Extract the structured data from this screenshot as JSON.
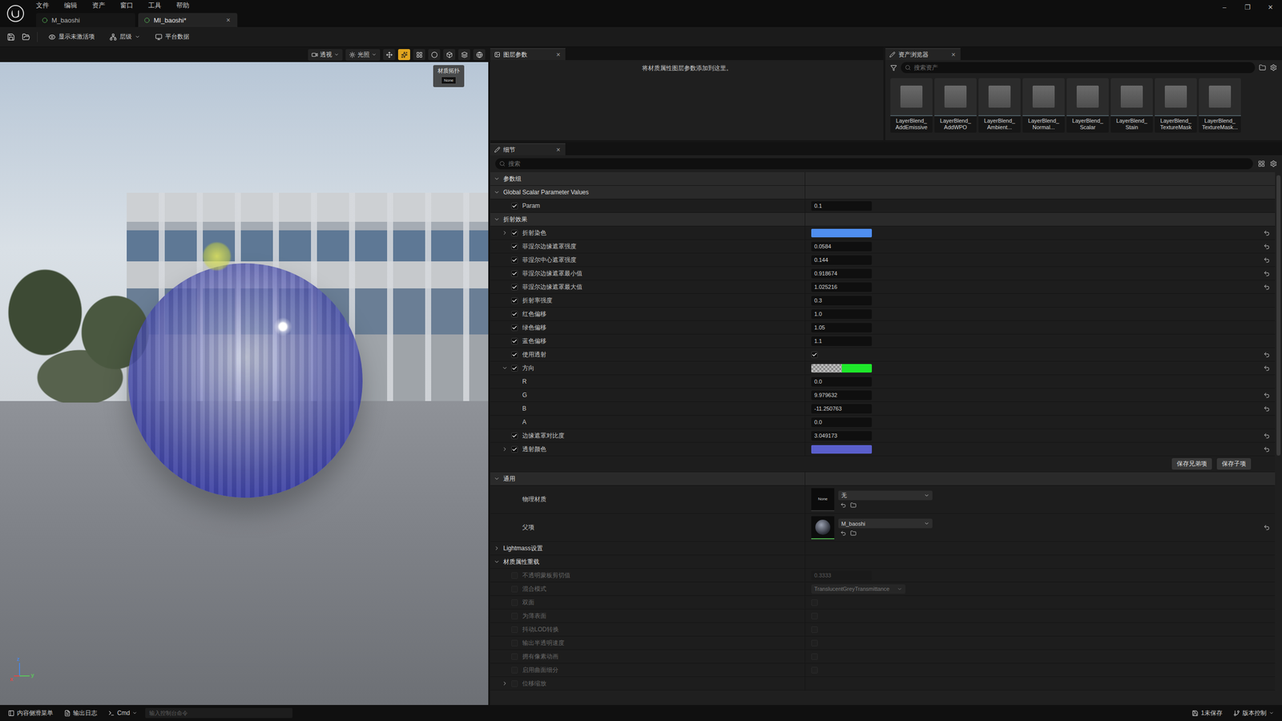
{
  "title_bar": {
    "menu": [
      "文件",
      "编辑",
      "资产",
      "窗口",
      "工具",
      "帮助"
    ],
    "tabs": [
      {
        "label": "M_baoshi",
        "selected": false,
        "closable": false
      },
      {
        "label": "MI_baoshi*",
        "selected": true,
        "closable": true
      }
    ],
    "close_glyph": "×",
    "window_controls": [
      "–",
      "❐",
      "✕"
    ]
  },
  "toolbar": {
    "items": [
      {
        "label": "显示未激活项",
        "dropdown": false
      },
      {
        "label": "层级",
        "dropdown": true
      },
      {
        "label": "平台数据",
        "dropdown": false
      }
    ]
  },
  "viewport": {
    "buttons": [
      {
        "label": "透视"
      },
      {
        "label": "光照"
      }
    ],
    "toggles": [
      {
        "selected": false
      },
      {
        "selected": true
      },
      {
        "selected": false
      },
      {
        "selected": false
      },
      {
        "selected": false
      },
      {
        "selected": false
      },
      {
        "selected": false
      }
    ],
    "topology": {
      "title": "材质拓扑",
      "value": "None"
    },
    "gizmo_axes": [
      {
        "label": "z",
        "color": "#4a86e0"
      },
      {
        "label": "x",
        "color": "#e04848"
      },
      {
        "label": "y",
        "color": "#5cc45c"
      }
    ]
  },
  "layer_params": {
    "tab": "图层参数",
    "close_glyph": "×",
    "message": "将材质属性图层参数添加到这里。"
  },
  "asset_browser": {
    "tab": "资产浏览器",
    "close_glyph": "×",
    "search_placeholder": "搜索资产",
    "assets": [
      {
        "lines": [
          "LayerBlend_",
          "AddEmissive"
        ]
      },
      {
        "lines": [
          "LayerBlend_",
          "AddWPO"
        ]
      },
      {
        "lines": [
          "LayerBlend_",
          "Ambient..."
        ]
      },
      {
        "lines": [
          "LayerBlend_",
          "Normal..."
        ]
      },
      {
        "lines": [
          "LayerBlend_",
          "Scalar"
        ]
      },
      {
        "lines": [
          "LayerBlend_",
          "Stain"
        ]
      },
      {
        "lines": [
          "LayerBlend_",
          "TextureMask"
        ]
      },
      {
        "lines": [
          "LayerBlend_",
          "TextureMask..."
        ]
      }
    ]
  },
  "details": {
    "tab": "细节",
    "close_glyph": "×",
    "search_placeholder": "搜索",
    "sections": [
      {
        "title": "参数组",
        "expanded": true,
        "rows": [],
        "buttons": []
      },
      {
        "title": "Global Scalar Parameter Values",
        "expanded": true,
        "buttons": [],
        "rows": [
          {
            "kind": "number",
            "label": "Param",
            "enabled": true,
            "value": "0.1",
            "modified": false
          }
        ]
      },
      {
        "title": "折射效果",
        "expanded": true,
        "buttons": [
          "保存兄弟项",
          "保存子项"
        ],
        "rows": [
          {
            "kind": "color",
            "label": "折射染色",
            "enabled": true,
            "expandable": true,
            "expanded": false,
            "color": "#4f8ef0",
            "transparent_part": false,
            "modified": true,
            "children": []
          },
          {
            "kind": "number",
            "label": "菲涅尔边缘遮罩强度",
            "enabled": true,
            "value": "0.0584",
            "modified": true
          },
          {
            "kind": "number",
            "label": "菲涅尔中心遮罩强度",
            "enabled": true,
            "value": "0.144",
            "modified": true
          },
          {
            "kind": "number",
            "label": "菲涅尔边缘遮罩最小值",
            "enabled": true,
            "value": "0.918674",
            "modified": true
          },
          {
            "kind": "number",
            "label": "菲涅尔边缘遮罩最大值",
            "enabled": true,
            "value": "1.025216",
            "modified": true
          },
          {
            "kind": "number",
            "label": "折射率强度",
            "enabled": true,
            "value": "0.3",
            "modified": false
          },
          {
            "kind": "number",
            "label": "红色偏移",
            "enabled": true,
            "value": "1.0",
            "modified": false
          },
          {
            "kind": "number",
            "label": "绿色偏移",
            "enabled": true,
            "value": "1.05",
            "modified": false
          },
          {
            "kind": "number",
            "label": "蓝色偏移",
            "enabled": true,
            "value": "1.1",
            "modified": false
          },
          {
            "kind": "checkbox",
            "label": "使用透射",
            "enabled": true,
            "value": true,
            "modified": true
          },
          {
            "kind": "color",
            "label": "方向",
            "enabled": true,
            "expandable": true,
            "expanded": true,
            "color": "#1ee82a",
            "transparent_part": true,
            "modified": true,
            "children": [
              {
                "kind": "number",
                "label": "R",
                "value": "0.0",
                "modified": false
              },
              {
                "kind": "number",
                "label": "G",
                "value": "9.979632",
                "modified": true
              },
              {
                "kind": "number",
                "label": "B",
                "value": "-11.250763",
                "modified": true
              },
              {
                "kind": "number",
                "label": "A",
                "value": "0.0",
                "modified": false
              }
            ]
          },
          {
            "kind": "number",
            "label": "边缘遮罩对比度",
            "enabled": true,
            "value": "3.049173",
            "modified": true
          },
          {
            "kind": "color",
            "label": "透射颜色",
            "enabled": true,
            "expandable": true,
            "expanded": false,
            "color": "#5a5fcc",
            "transparent_part": false,
            "modified": true,
            "children": []
          }
        ]
      },
      {
        "title": "通用",
        "expanded": true,
        "buttons": [],
        "rows": [
          {
            "kind": "asset",
            "label": "物理材质",
            "thumbnail_text": "None",
            "value": "无",
            "modified": false
          },
          {
            "kind": "asset",
            "label": "父项",
            "value": "M_baoshi",
            "modified": true
          },
          {
            "kind": "group",
            "label": "Lightmass设置",
            "expanded": false
          },
          {
            "kind": "group",
            "label": "材质属性重载",
            "expanded": true
          },
          {
            "kind": "number",
            "label": "不透明蒙板剪切值",
            "enabled": false,
            "disabled": true,
            "value": "0.3333",
            "modified": false
          },
          {
            "kind": "dropdown",
            "label": "混合模式",
            "enabled": false,
            "disabled": true,
            "value": "TranslucentGreyTransmittance",
            "modified": false
          },
          {
            "kind": "checkbox",
            "label": "双面",
            "enabled": false,
            "disabled": true,
            "value": false,
            "modified": false
          },
          {
            "kind": "checkbox",
            "label": "为薄表面",
            "enabled": false,
            "disabled": true,
            "value": false,
            "modified": false
          },
          {
            "kind": "checkbox",
            "label": "抖动LOD转换",
            "enabled": false,
            "disabled": true,
            "value": false,
            "modified": false
          },
          {
            "kind": "checkbox",
            "label": "输出半透明速度",
            "enabled": false,
            "disabled": true,
            "value": false,
            "modified": false
          },
          {
            "kind": "checkbox",
            "label": "拥有像素动画",
            "enabled": false,
            "disabled": true,
            "value": false,
            "modified": false
          },
          {
            "kind": "checkbox",
            "label": "启用曲面细分",
            "enabled": false,
            "disabled": true,
            "value": false,
            "modified": false
          },
          {
            "kind": "group",
            "label": "位移缩放",
            "enabled": false,
            "disabled": true,
            "expanded": false
          }
        ]
      }
    ]
  },
  "status_bar": {
    "left": [
      {
        "label": "内容侧滑菜单",
        "dropdown": false
      },
      {
        "label": "输出日志",
        "dropdown": false
      },
      {
        "label": "Cmd",
        "dropdown": true
      }
    ],
    "console_placeholder": "输入控制台命令",
    "right": [
      {
        "label": "1未保存",
        "dropdown": false
      },
      {
        "label": "版本控制",
        "dropdown": true
      }
    ]
  }
}
